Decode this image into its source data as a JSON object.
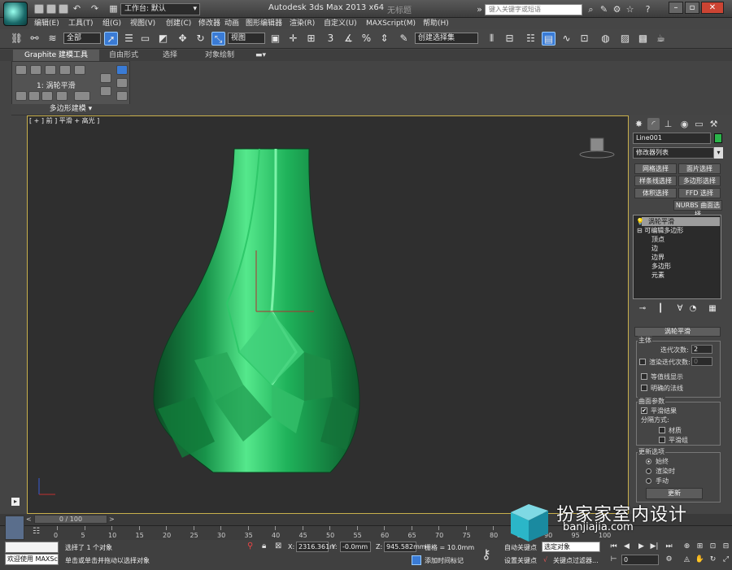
{
  "titlebar": {
    "workspace": "工作台: 默认",
    "title": "Autodesk 3ds Max  2013 x64",
    "doc": "无标题",
    "search_placeholder": "键入关键字或短语"
  },
  "menu": [
    "编辑(E)",
    "工具(T)",
    "组(G)",
    "视图(V)",
    "创建(C)",
    "修改器",
    "动画",
    "图形编辑器",
    "渲染(R)",
    "自定义(U)",
    "MAXScript(M)",
    "帮助(H)"
  ],
  "toolbar": {
    "filter": "全部",
    "coord_system": "视图",
    "named_selection": "创建选择集"
  },
  "ribbon": {
    "tabs": [
      "Graphite 建模工具",
      "自由形式",
      "选择",
      "对象绘制"
    ],
    "item_label": "1: 涡轮平滑",
    "group_label": "多边形建模 ▾"
  },
  "viewport": {
    "label": "[ + ] 前 ] 平滑 + 高光 ]"
  },
  "command_panel": {
    "object_name": "Line001",
    "object_color": "#2bb54a",
    "modifier_list": "修改器列表",
    "sel_buttons": [
      [
        "网格选择",
        "面片选择"
      ],
      [
        "样条线选择",
        "多边形选择"
      ],
      [
        "体积选择",
        "FFD 选择"
      ]
    ],
    "nurbs_button": "NURBS 曲面选择",
    "stack": [
      "涡轮平滑",
      "可编辑多边形",
      "顶点",
      "边",
      "边界",
      "多边形",
      "元素"
    ],
    "rollout_title": "涡轮平滑",
    "main_group": "主体",
    "iterations_label": "迭代次数:",
    "iterations_value": "2",
    "render_iters_label": "渲染迭代次数:",
    "render_iters_value": "0",
    "isoline_label": "等值线显示",
    "explicit_normals_label": "明确的法线",
    "surface_group": "曲面参数",
    "smooth_result_label": "平滑结果",
    "separate_label": "分隔方式:",
    "materials_label": "材质",
    "smoothing_groups_label": "平滑组",
    "update_group": "更新选项",
    "always_label": "始终",
    "when_rendering_label": "渲染时",
    "manually_label": "手动",
    "update_button": "更新"
  },
  "timeline": {
    "slider": "0 / 100",
    "ticks": [
      "0",
      "5",
      "10",
      "15",
      "20",
      "25",
      "30",
      "35",
      "40",
      "45",
      "50",
      "55",
      "60",
      "65",
      "70",
      "75",
      "80",
      "85",
      "90",
      "95",
      "100"
    ]
  },
  "status": {
    "maxscript_label": "欢迎使用 MAXSc",
    "selected": "选择了 1 个对象",
    "prompt": "单击或单击并拖动以选择对象",
    "x_label": "X:",
    "x_value": "2316.361n",
    "y_label": "Y:",
    "y_value": "-0.0mm",
    "z_label": "Z:",
    "z_value": "945.582mm",
    "grid": "栅格 = 10.0mm",
    "add_time_tag": "添加时间标记",
    "auto_key": "自动关键点",
    "set_key": "设置关键点",
    "selection_set": "选定对象",
    "key_filters": "关键点过滤器...",
    "frame": "0"
  },
  "watermark": {
    "title": "扮家家室内设计",
    "url": "banjiajia.com"
  }
}
